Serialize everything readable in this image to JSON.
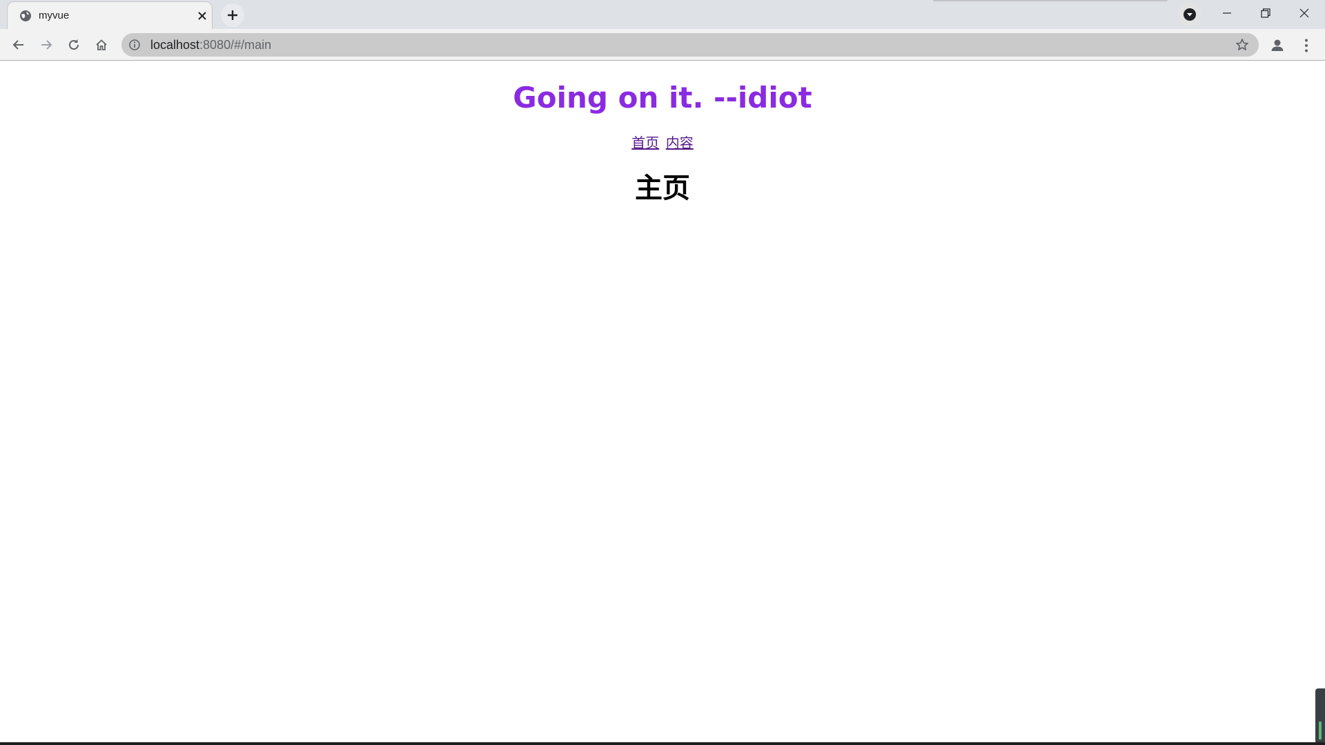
{
  "browser": {
    "tab": {
      "title": "myvue"
    },
    "address_bar": {
      "host": "localhost",
      "path": ":8080/#/main"
    },
    "icons": {
      "favicon": "globe-icon",
      "tab_close": "close-icon",
      "new_tab": "plus-icon",
      "tab_search": "chevron-down-icon",
      "back": "arrow-left-icon",
      "forward": "arrow-right-icon",
      "reload": "reload-icon",
      "home": "home-icon",
      "site_info": "info-icon",
      "bookmark": "star-icon",
      "profile": "person-icon",
      "menu": "more-vertical-icon",
      "minimize": "minimize-icon",
      "restore": "restore-icon",
      "close_window": "close-icon"
    }
  },
  "page": {
    "title": "Going on it. --idiot",
    "nav": [
      {
        "label": "首页"
      },
      {
        "label": "内容"
      }
    ],
    "heading": "主页"
  },
  "colors": {
    "title": "#8a2be2",
    "link_visited": "#551a8b",
    "heading": "#000000",
    "tabstrip": "#dee1e6",
    "toolbar": "#f2f2f2",
    "omnibox": "#cacaca"
  }
}
